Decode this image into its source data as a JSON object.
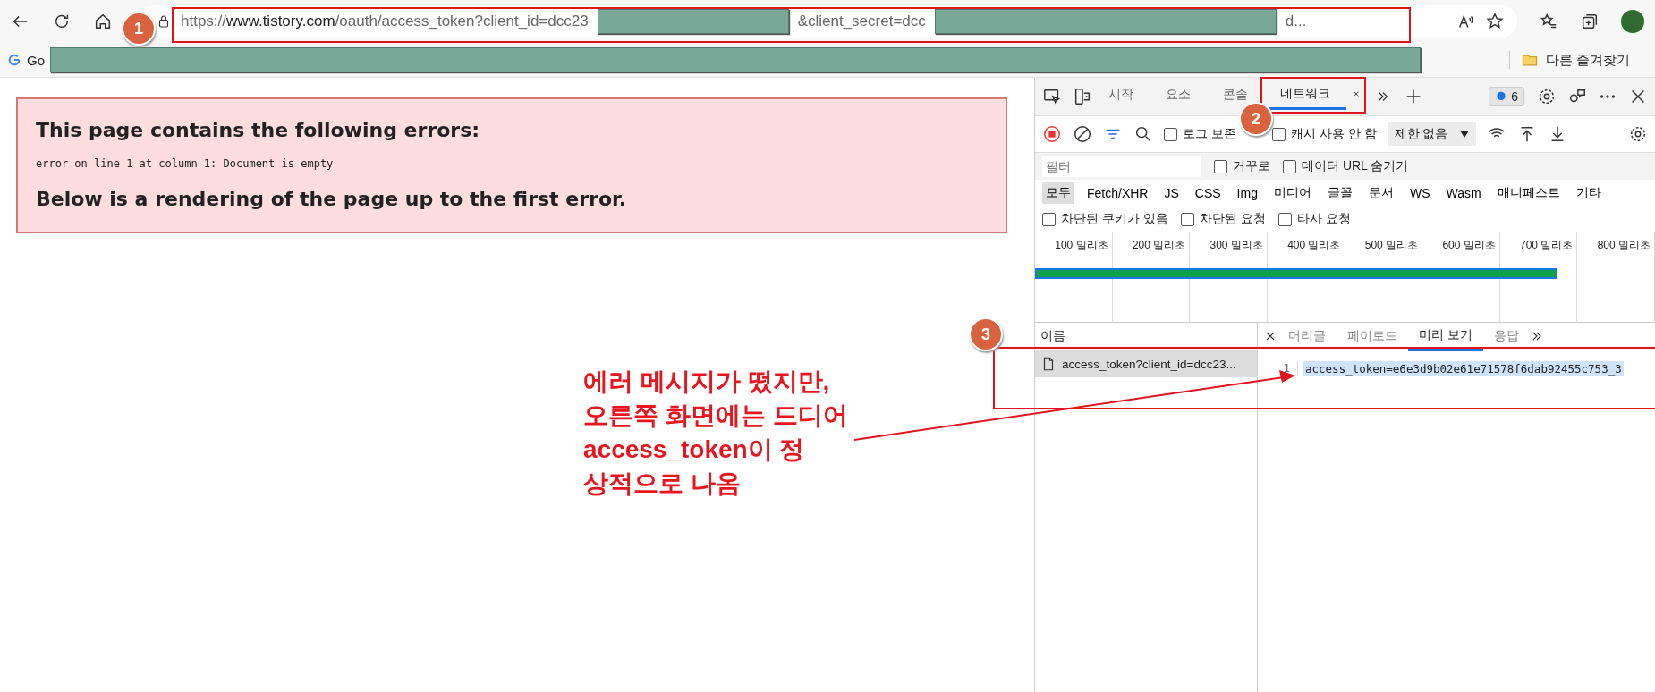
{
  "address_bar": {
    "scheme": "https://",
    "host": "www.tistory.com",
    "path": "/oauth/access_token?client_id=dcc23",
    "middle": "&client_secret=dcc",
    "end": "d..."
  },
  "bookmarks_bar": {
    "first": "Go",
    "other_folder": "다른 즐겨찾기"
  },
  "error_page": {
    "heading": "This page contains the following errors:",
    "detail": "error on line 1 at column 1: Document is empty",
    "footer": "Below is a rendering of the page up to the first error."
  },
  "devtools": {
    "tabs": [
      {
        "label": "시작",
        "selected": false
      },
      {
        "label": "요소",
        "selected": false
      },
      {
        "label": "콘솔",
        "selected": false
      },
      {
        "label": "네트워크",
        "selected": true
      }
    ],
    "issues_count": "6",
    "toolbar_checkboxes": [
      {
        "label": "로그 보존",
        "checked": false
      },
      {
        "label": "캐시 사용 안 함",
        "checked": false
      }
    ],
    "throttle": "제한 없음",
    "filter_placeholder": "필터",
    "filter_checkboxes": [
      {
        "label": "거꾸로",
        "checked": false
      },
      {
        "label": "데이터 URL 숨기기",
        "checked": false
      }
    ],
    "type_filters": [
      {
        "label": "모두",
        "selected": true
      },
      {
        "label": "Fetch/XHR",
        "selected": false
      },
      {
        "label": "JS",
        "selected": false
      },
      {
        "label": "CSS",
        "selected": false
      },
      {
        "label": "Img",
        "selected": false
      },
      {
        "label": "미디어",
        "selected": false
      },
      {
        "label": "글꼴",
        "selected": false
      },
      {
        "label": "문서",
        "selected": false
      },
      {
        "label": "WS",
        "selected": false
      },
      {
        "label": "Wasm",
        "selected": false
      },
      {
        "label": "매니페스트",
        "selected": false
      },
      {
        "label": "기타",
        "selected": false
      }
    ],
    "request_checkboxes": [
      {
        "label": "차단된 쿠키가 있음",
        "checked": false
      },
      {
        "label": "차단된 요청",
        "checked": false
      },
      {
        "label": "타사 요청",
        "checked": false
      }
    ],
    "timeline_ticks": [
      "100 밀리초",
      "200 밀리초",
      "300 밀리초",
      "400 밀리초",
      "500 밀리초",
      "600 밀리초",
      "700 밀리초",
      "800 밀리초"
    ],
    "name_header": "이름",
    "requests": [
      {
        "name": "access_token?client_id=dcc23...",
        "selected": true
      }
    ],
    "detail_tabs": [
      {
        "label": "머리글",
        "selected": false
      },
      {
        "label": "페이로드",
        "selected": false
      },
      {
        "label": "미리 보기",
        "selected": true
      },
      {
        "label": "응답",
        "selected": false
      }
    ],
    "preview_lines": [
      {
        "number": "1",
        "text": "access_token=e6e3d9b02e61e71578f6dab92455c753_3"
      }
    ]
  },
  "annotation": {
    "badges": [
      "1",
      "2",
      "3"
    ],
    "note": "에러 메시지가 떴지만,\n오른쪽 화면에는 드디어\n**access_token**이 정\n상적으로 나옴"
  }
}
